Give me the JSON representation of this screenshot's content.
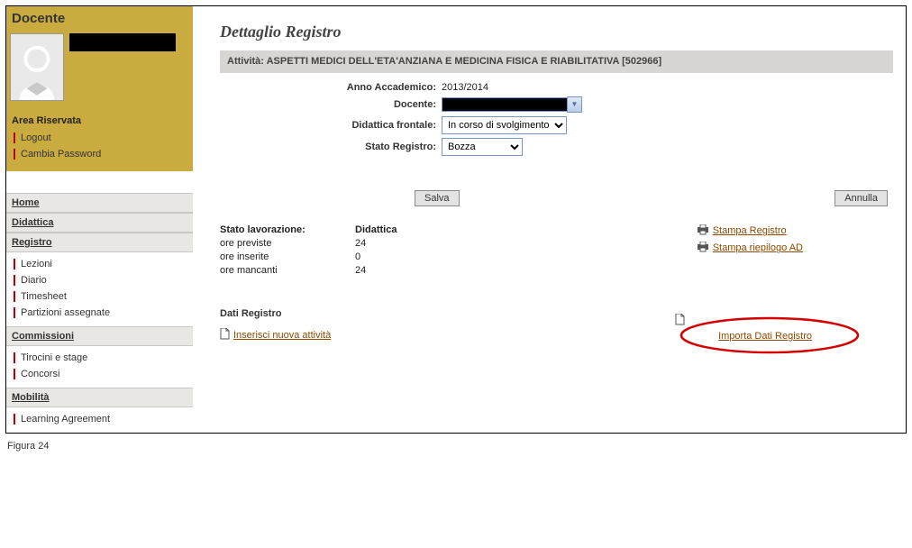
{
  "sidebar": {
    "title": "Docente",
    "reserved_header": "Area Riservata",
    "logout": "Logout",
    "change_password": "Cambia Password",
    "nav": {
      "home": "Home",
      "didattica": "Didattica",
      "registro": "Registro",
      "registro_items": [
        "Lezioni",
        "Diario",
        "Timesheet",
        "Partizioni assegnate"
      ],
      "commissioni": "Commissioni",
      "commissioni_items": [
        "Tirocini e stage",
        "Concorsi"
      ],
      "mobilita": "Mobilità",
      "mobilita_items": [
        "Learning Agreement"
      ]
    }
  },
  "main": {
    "title": "Dettaglio Registro",
    "activity_label": "Attività:",
    "activity_value": "ASPETTI MEDICI DELL'ETA'ANZIANA E MEDICINA FISICA E RIABILITATIVA [502966]",
    "fields": {
      "anno_label": "Anno Accademico:",
      "anno_value": "2013/2014",
      "docente_label": "Docente:",
      "didattica_label": "Didattica frontale:",
      "didattica_value": "In corso di svolgimento",
      "stato_label": "Stato Registro:",
      "stato_value": "Bozza"
    },
    "buttons": {
      "save": "Salva",
      "cancel": "Annulla"
    },
    "lavorazione": {
      "stato_header": "Stato lavorazione:",
      "col_header": "Didattica",
      "ore_previste_label": "ore previste",
      "ore_previste_val": "24",
      "ore_inserite_label": "ore inserite",
      "ore_inserite_val": "0",
      "ore_mancanti_label": "ore mancanti",
      "ore_mancanti_val": "24"
    },
    "print_links": {
      "stampa_registro": "Stampa Registro",
      "stampa_riepilogo": "Stampa riepilogo AD"
    },
    "dati": {
      "header": "Dati Registro",
      "inserisci": "Inserisci nuova attività",
      "importa": "Importa Dati Registro"
    }
  },
  "caption": "Figura 24"
}
